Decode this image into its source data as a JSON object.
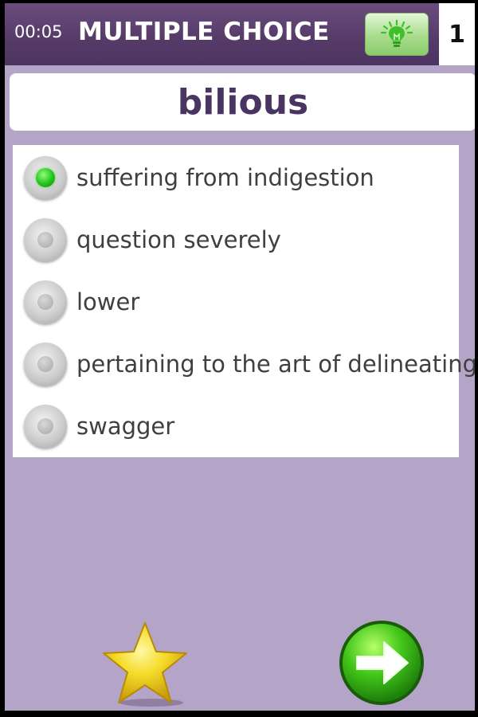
{
  "header": {
    "timer": "00:05",
    "mode_title": "MULTIPLE CHOICE",
    "hint_icon": "lightbulb-icon",
    "counter": "1"
  },
  "question": {
    "word": "bilious"
  },
  "options": [
    {
      "label": "suffering from indigestion",
      "selected": true
    },
    {
      "label": "question severely",
      "selected": false
    },
    {
      "label": "lower",
      "selected": false
    },
    {
      "label": "pertaining to the art of delineating",
      "selected": false
    },
    {
      "label": "swagger",
      "selected": false
    }
  ],
  "footer": {
    "favorite_icon": "star-icon",
    "next_icon": "arrow-right-icon"
  },
  "colors": {
    "header_bg": "#553a68",
    "background": "#b3a4c8",
    "word_text": "#4a3462",
    "selected_radio": "#22c21a",
    "hint_button": "#a8dc8c"
  }
}
